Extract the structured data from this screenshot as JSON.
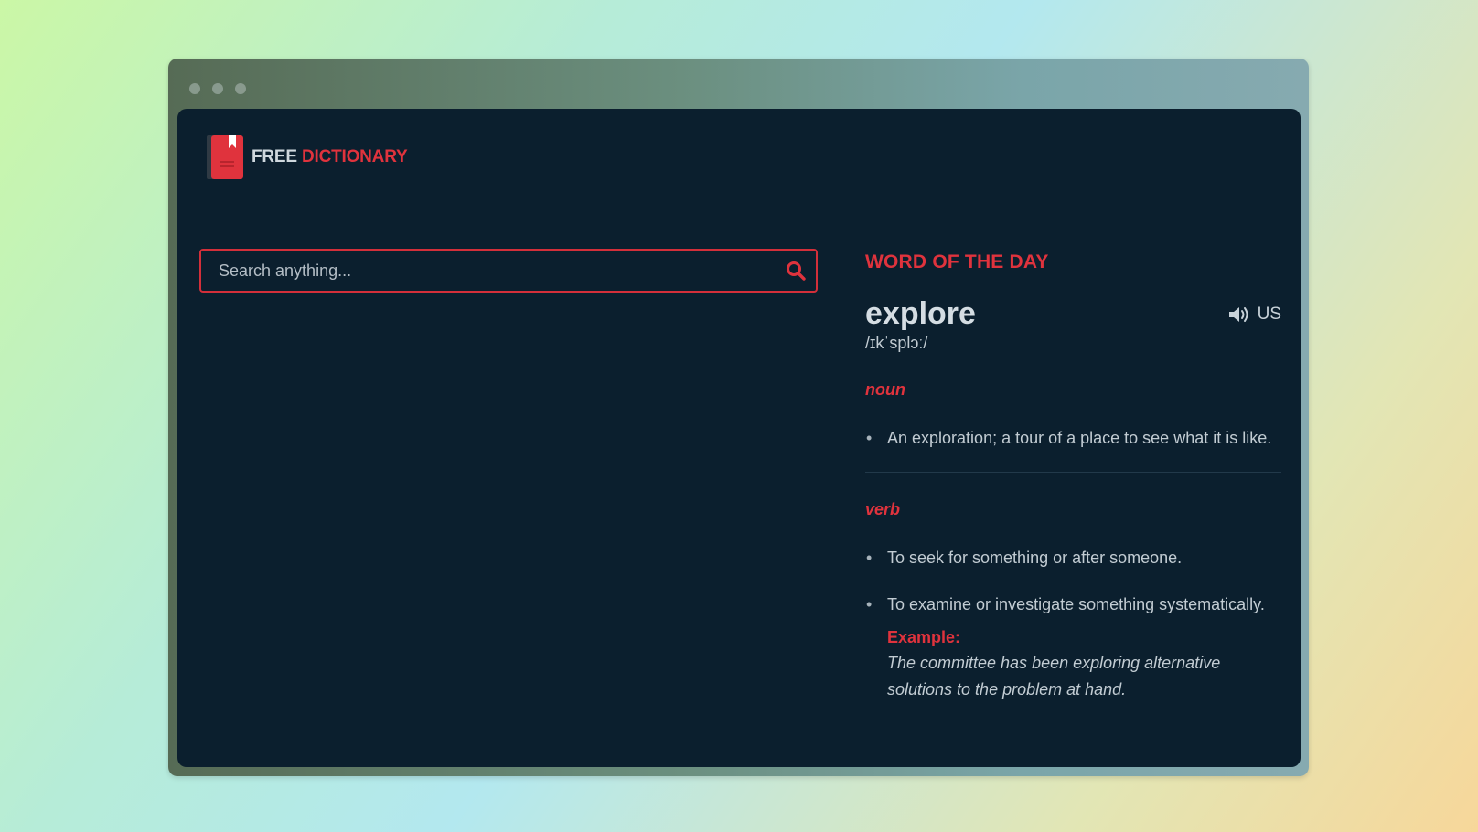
{
  "brand": {
    "free": "FREE",
    "dictionary": "DICTIONARY"
  },
  "search": {
    "placeholder": "Search anything...",
    "value": ""
  },
  "word_of_day": {
    "heading": "WORD OF THE DAY",
    "word": "explore",
    "audio_label": "US",
    "phonetic": "/ɪkˈsplɔː/",
    "noun": {
      "label": "noun",
      "definitions": [
        "An exploration; a tour of a place to see what it is like."
      ]
    },
    "verb": {
      "label": "verb",
      "definitions": [
        "To seek for something or after someone.",
        "To examine or investigate something systematically."
      ],
      "example_label": "Example:",
      "example_text": "The committee has been exploring alternative solutions to the problem at hand."
    }
  },
  "colors": {
    "accent": "#e0333d",
    "background": "#0b1f2e",
    "text": "#c2ccd3"
  },
  "icons": {
    "logo": "book-icon",
    "search": "search-icon",
    "audio": "speaker-icon"
  }
}
